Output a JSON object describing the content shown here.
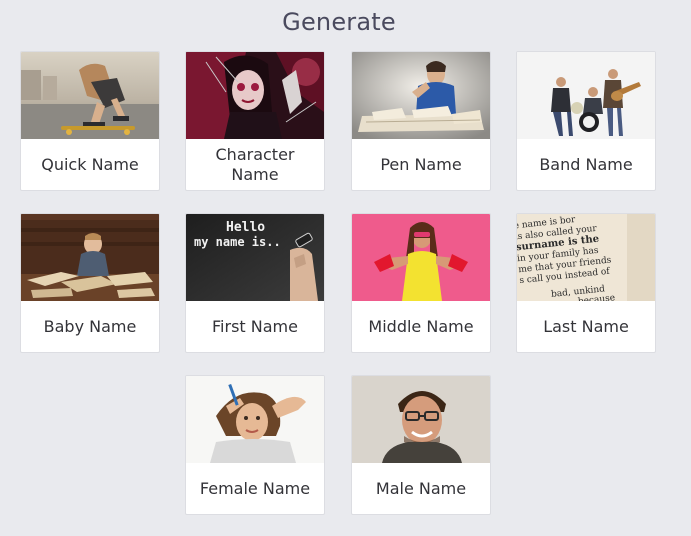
{
  "header": {
    "title": "Generate"
  },
  "cards": [
    {
      "label": "Quick Name",
      "image": "skateboarder-photo"
    },
    {
      "label": "Character Name",
      "image": "costumed-character-photo"
    },
    {
      "label": "Pen Name",
      "image": "writer-with-books-photo"
    },
    {
      "label": "Band Name",
      "image": "rock-band-photo"
    },
    {
      "label": "Baby Name",
      "image": "baby-with-books-photo"
    },
    {
      "label": "First Name",
      "image": "hello-my-name-is-photo"
    },
    {
      "label": "Middle Name",
      "image": "woman-pink-background-photo"
    },
    {
      "label": "Last Name",
      "image": "dictionary-surname-photo"
    },
    {
      "label": "Female Name",
      "image": "thinking-woman-photo"
    },
    {
      "label": "Male Name",
      "image": "smiling-man-photo"
    }
  ],
  "image_text": {
    "hello_line1": "Hello",
    "hello_line2": "my name is..",
    "dict_lines": [
      "e name is bor",
      "is also called your",
      "surname is the",
      "in your family has",
      "me that your friends",
      "s call you instead of",
      "bad, unkind",
      "because"
    ]
  }
}
